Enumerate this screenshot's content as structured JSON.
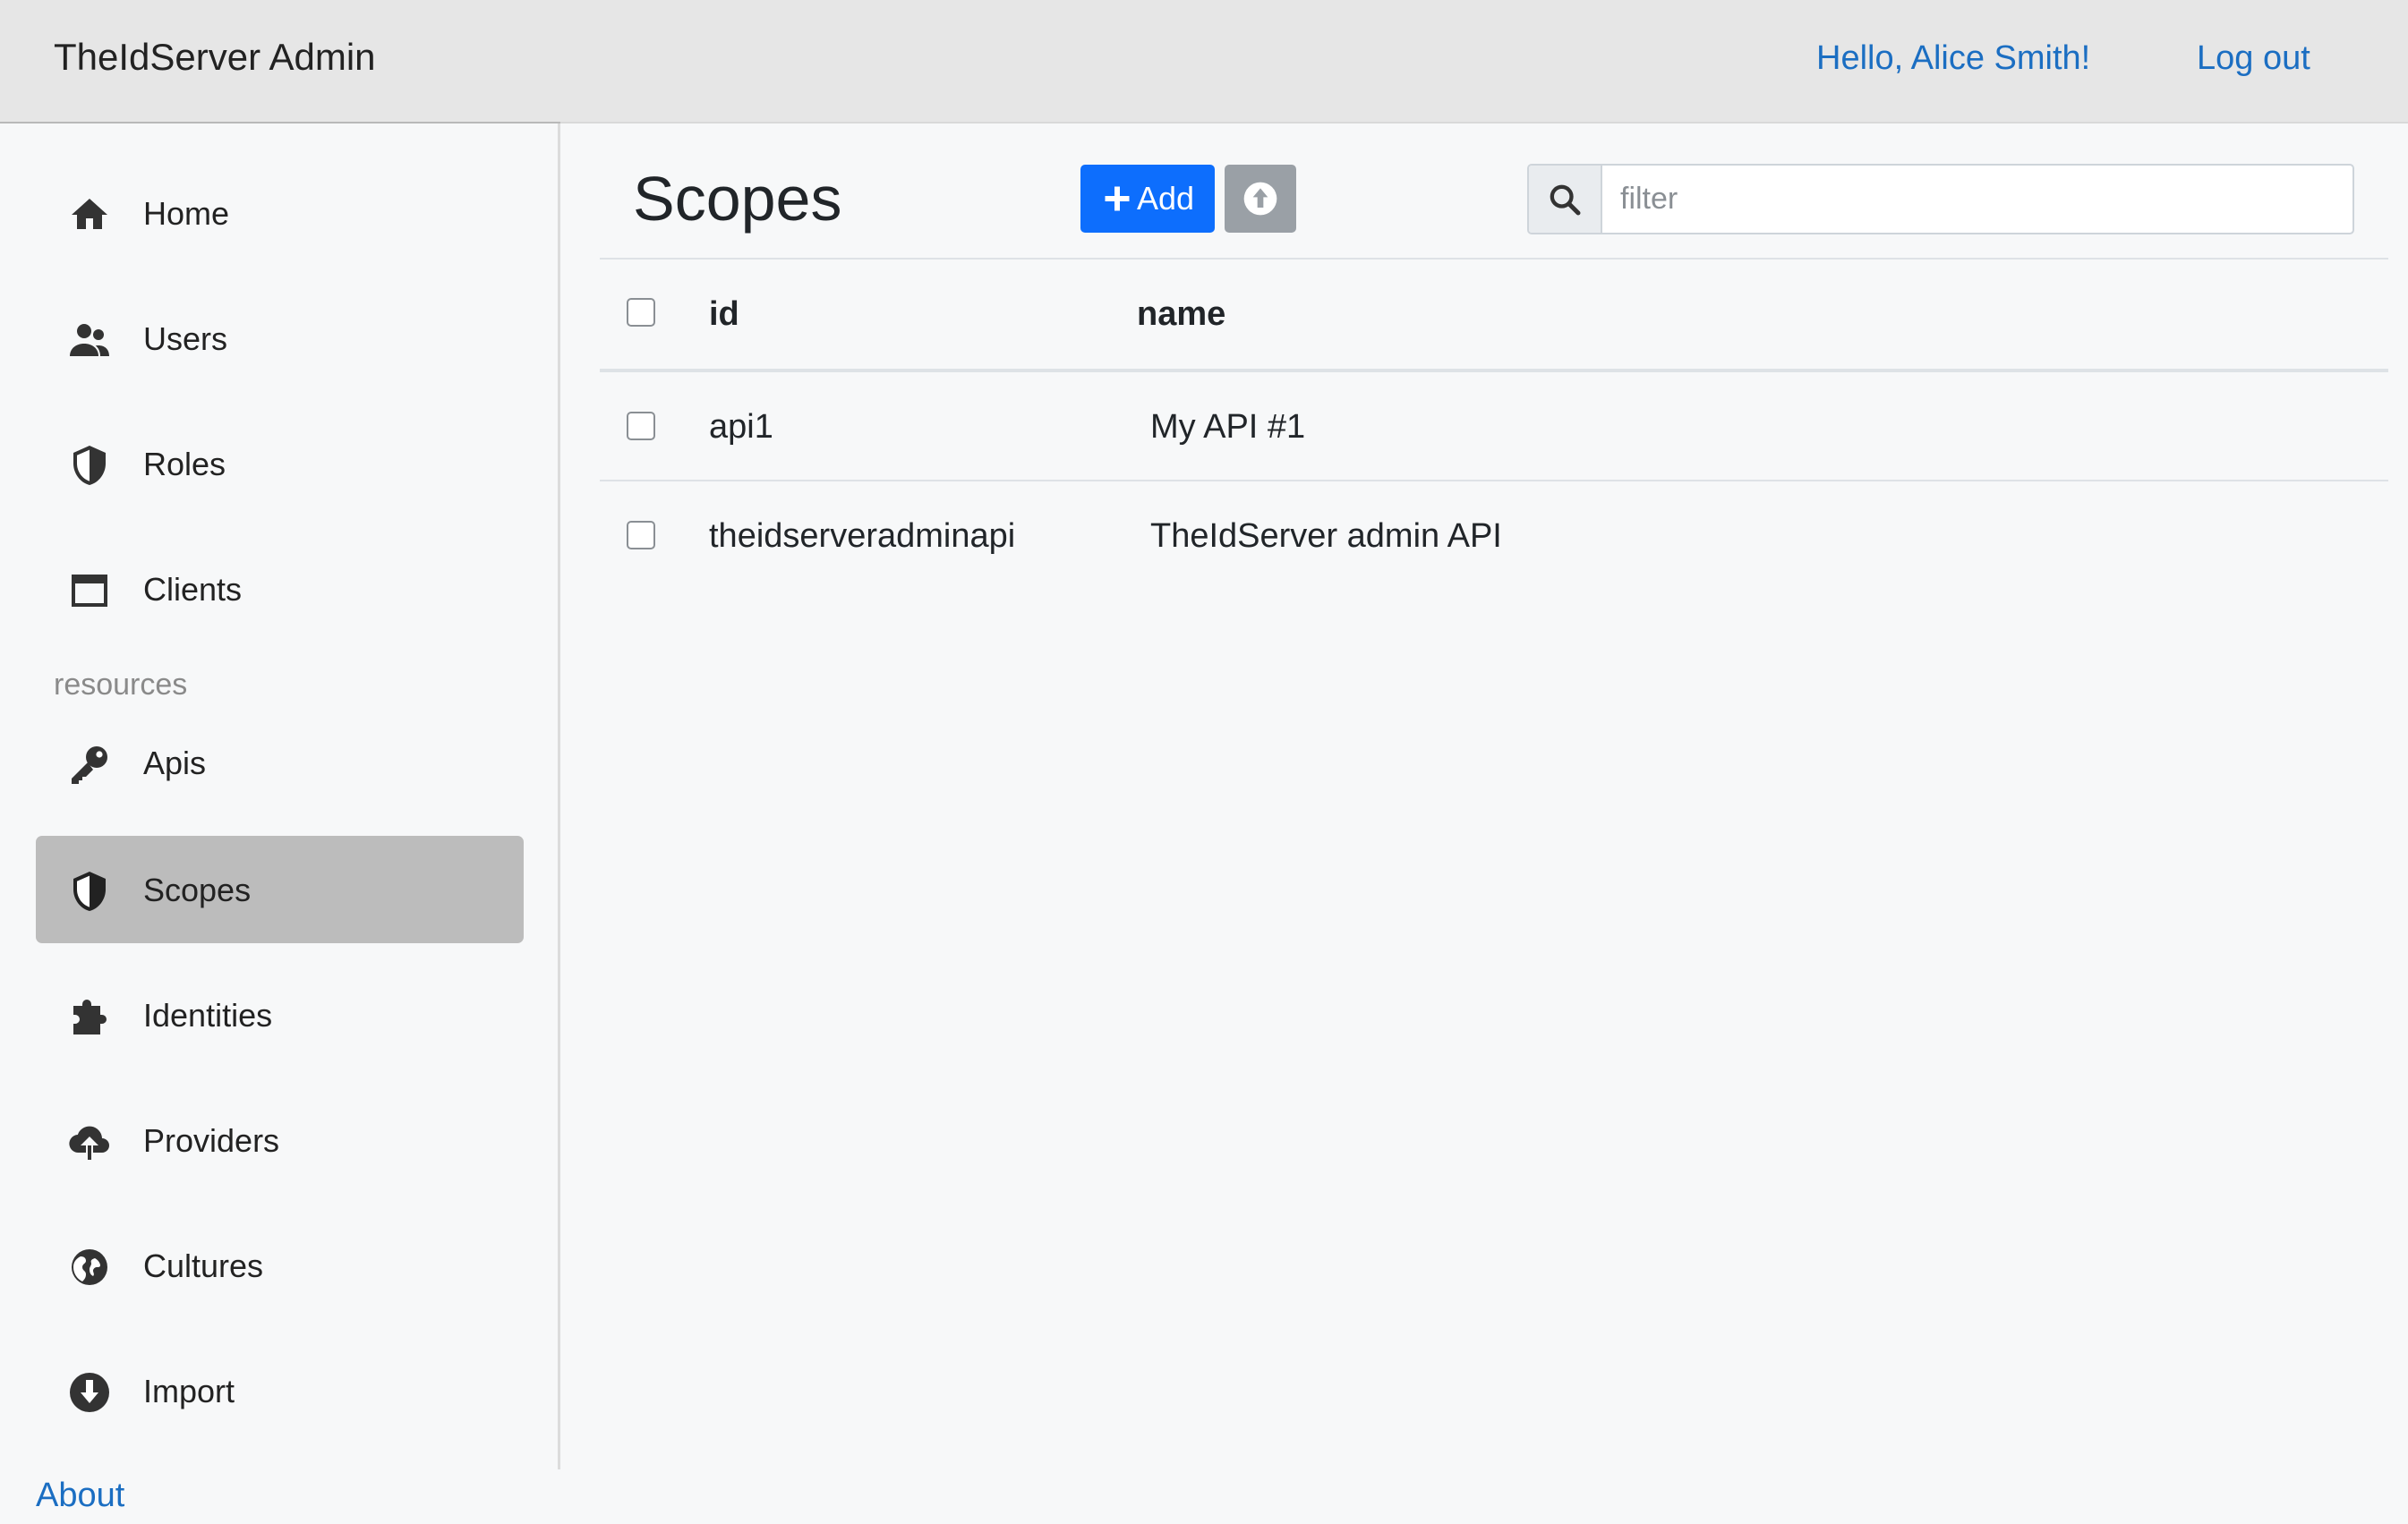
{
  "app": {
    "brand": "TheIdServer Admin"
  },
  "header": {
    "greeting": "Hello, Alice Smith!",
    "logout_label": "Log out"
  },
  "sidebar": {
    "items": [
      {
        "label": "Home",
        "icon": "home-icon"
      },
      {
        "label": "Users",
        "icon": "users-icon"
      },
      {
        "label": "Roles",
        "icon": "shield-icon"
      },
      {
        "label": "Clients",
        "icon": "window-icon"
      },
      {
        "label": "Apis",
        "icon": "key-icon"
      },
      {
        "label": "Scopes",
        "icon": "shield-icon",
        "active": true
      },
      {
        "label": "Identities",
        "icon": "puzzle-icon"
      },
      {
        "label": "Providers",
        "icon": "cloud-upload-icon"
      },
      {
        "label": "Cultures",
        "icon": "globe-icon"
      },
      {
        "label": "Import",
        "icon": "download-circle-icon"
      }
    ],
    "section_label": "resources",
    "about_label": "About"
  },
  "main": {
    "title": "Scopes",
    "add_label": "Add",
    "search": {
      "placeholder": "filter",
      "value": ""
    },
    "columns": [
      "id",
      "name"
    ],
    "rows": [
      {
        "id": "api1",
        "name": "My API #1"
      },
      {
        "id": "theidserveradminapi",
        "name": "TheIdServer admin API"
      }
    ]
  },
  "colors": {
    "link": "#1b6ec2",
    "primary": "#0d6efd",
    "secondary": "#9aa0a6",
    "active_nav": "#bcbcbc",
    "topbar": "#e6e6e6"
  }
}
